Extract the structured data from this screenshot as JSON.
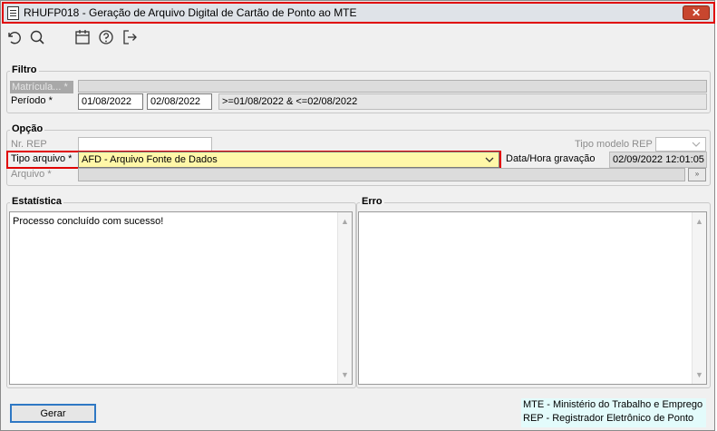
{
  "window": {
    "title": "RHUFP018 - Geração de Arquivo Digital de Cartão de Ponto ao MTE",
    "close_glyph": "✕"
  },
  "toolbar": {
    "buttons": [
      {
        "icon": "undo-icon"
      },
      {
        "icon": "search-icon"
      },
      {
        "icon": "calendar-icon"
      },
      {
        "icon": "help-icon"
      },
      {
        "icon": "exit-icon"
      }
    ]
  },
  "filtro": {
    "title": "Filtro",
    "matricula_label": "Matrícula... *",
    "matricula_value": "",
    "periodo_label": "Período *",
    "periodo_inicio": "01/08/2022",
    "periodo_fim": "02/08/2022",
    "periodo_expr": ">=01/08/2022 & <=02/08/2022"
  },
  "opcao": {
    "title": "Opção",
    "nr_rep_label": "Nr. REP",
    "nr_rep_value": "",
    "tipo_modelo_label": "Tipo modelo REP",
    "tipo_modelo_value": "",
    "tipo_arquivo_label": "Tipo arquivo *",
    "tipo_arquivo_value": "AFD - Arquivo Fonte de Dados",
    "data_hora_label": "Data/Hora gravação",
    "data_hora_value": "02/09/2022 12:01:05",
    "arquivo_label": "Arquivo *",
    "arquivo_value": "",
    "browse_glyph": "»"
  },
  "estatistica": {
    "title": "Estatística",
    "text": "Processo concluído com sucesso!"
  },
  "erro": {
    "title": "Erro",
    "text": ""
  },
  "footer": {
    "gerar_label": "Gerar",
    "legend": [
      "MTE - Ministério do Trabalho e Emprego",
      "REP - Registrador Eletrônico de Ponto"
    ]
  },
  "colors": {
    "highlight_border": "#e00000",
    "tipo_arquivo_bg": "#fff7a8",
    "legend_bg": "#e3fbfb",
    "gerar_border": "#2f78c4"
  }
}
